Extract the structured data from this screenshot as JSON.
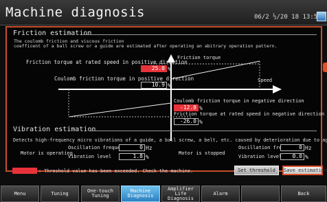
{
  "header": {
    "title": "Machine diagnosis",
    "datetime": "06/2 ½/20 18  13:52"
  },
  "friction": {
    "section_title": "Friction estimation",
    "desc_line1": "The coulomb friction and viscous friction",
    "desc_line2": "coefficent of a ball screw or a guide are estimated after operating an abitrary operation pattern.",
    "axis_torque_label": "Friction torque",
    "axis_speed_label": "Speed",
    "rated_pos_label": "Friction torque at rated speed in positive direction",
    "rated_pos_value": "25.0",
    "coulomb_pos_label": "Coulomb friction torque in positive direction",
    "coulomb_pos_value": "10.9",
    "coulomb_neg_label": "Coulomb friction torque in negative direction",
    "coulomb_neg_value": "-12.8",
    "rated_neg_label": "Friction torque at rated speed in negative direction",
    "rated_neg_value": "-26.0",
    "unit": "%"
  },
  "vibration": {
    "section_title": "Vibration estimation",
    "desc": "Detects high-frequency micro vibrations of a guide, a ball screw, a belt, etc. caused by deterioration due to age.",
    "operating_label": "Motor is operating",
    "stopped_label": "Motor is stopped",
    "osc_freq_label": "Oscillation frequency",
    "vib_level_label": "Vibration level",
    "op_freq_value": "0",
    "op_level_value": "1.8",
    "stop_freq_value": "0",
    "stop_level_value": "0.0",
    "freq_unit": "Hz",
    "level_unit": "%"
  },
  "footer": {
    "legend_text": ": Threshold value has been exceeded. Check the machine.",
    "set_threshold": "Set threshold",
    "save_estimation": "Save estimation"
  },
  "nav": {
    "menu": "Menu",
    "tuning": "Tuning",
    "onetouch": "One-touch\nTuning",
    "machine": "Machine\nDiagnosis",
    "amplifier": "Amplifier Life\nDiagnosis",
    "alarm": "Alarm",
    "back": "Back"
  },
  "colors": {
    "threshold_exceeded": "#e8323a",
    "accent": "#e0502a",
    "active_tab": "#3a96d8"
  }
}
